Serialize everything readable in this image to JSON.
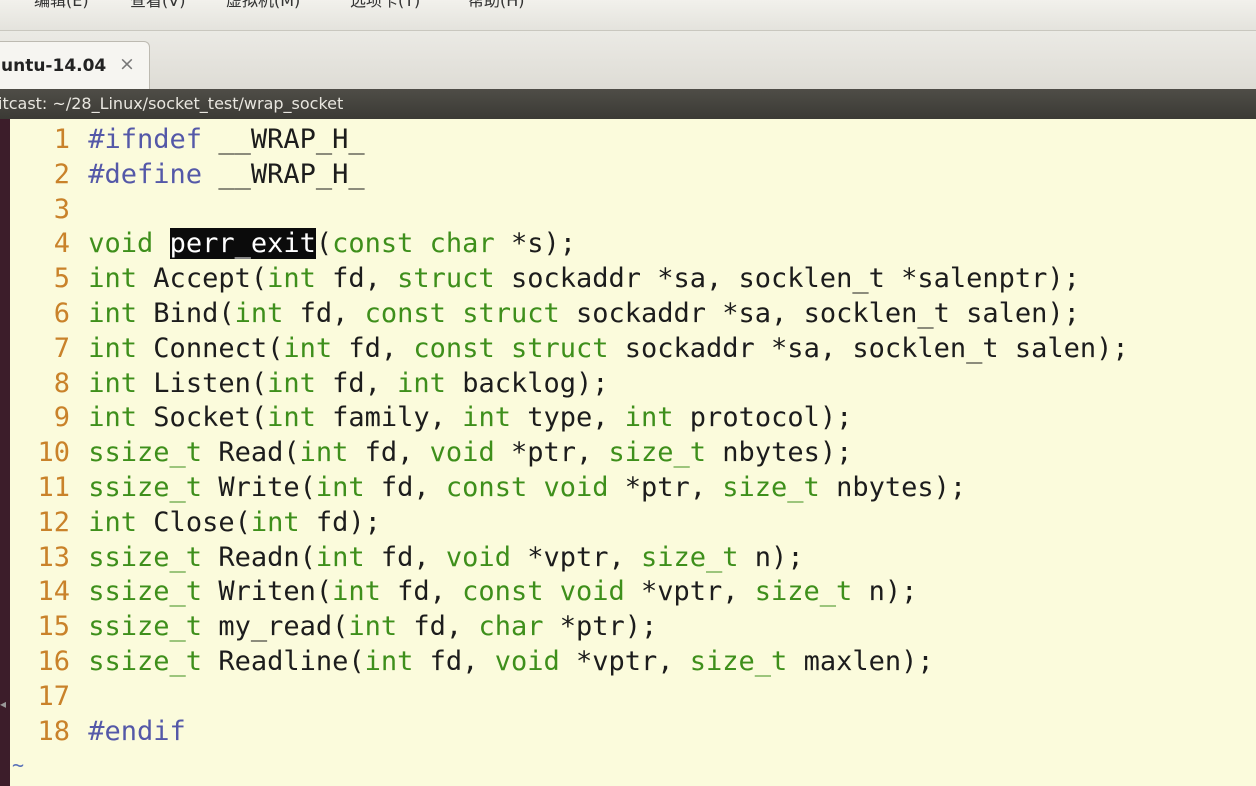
{
  "menubar": {
    "items": [
      "",
      "编辑(E)",
      "查看(V)",
      "虚拟机(M)",
      "选项卡(T)",
      "帮助(H)"
    ]
  },
  "tab": {
    "title": "untu-14.04",
    "close_glyph": "×"
  },
  "terminal": {
    "title": "itcast: ~/28_Linux/socket_test/wrap_socket"
  },
  "editor": {
    "lines": [
      {
        "n": "1",
        "segs": [
          [
            "pp",
            "#ifndef"
          ],
          [
            "t",
            " __WRAP_H_"
          ]
        ]
      },
      {
        "n": "2",
        "segs": [
          [
            "pp",
            "#define"
          ],
          [
            "t",
            " __WRAP_H_"
          ]
        ]
      },
      {
        "n": "3",
        "segs": []
      },
      {
        "n": "4",
        "segs": [
          [
            "kw",
            "void"
          ],
          [
            "t",
            " "
          ],
          [
            "hl",
            "perr_exit"
          ],
          [
            "t",
            "("
          ],
          [
            "kw",
            "const char"
          ],
          [
            "t",
            " *s);"
          ]
        ]
      },
      {
        "n": "5",
        "segs": [
          [
            "kw",
            "int"
          ],
          [
            "t",
            " Accept("
          ],
          [
            "kw",
            "int"
          ],
          [
            "t",
            " fd, "
          ],
          [
            "kw",
            "struct"
          ],
          [
            "t",
            " sockaddr *sa, socklen_t *salenptr);"
          ]
        ]
      },
      {
        "n": "6",
        "segs": [
          [
            "kw",
            "int"
          ],
          [
            "t",
            " Bind("
          ],
          [
            "kw",
            "int"
          ],
          [
            "t",
            " fd, "
          ],
          [
            "kw",
            "const struct"
          ],
          [
            "t",
            " sockaddr *sa, socklen_t salen);"
          ]
        ]
      },
      {
        "n": "7",
        "segs": [
          [
            "kw",
            "int"
          ],
          [
            "t",
            " Connect("
          ],
          [
            "kw",
            "int"
          ],
          [
            "t",
            " fd, "
          ],
          [
            "kw",
            "const struct"
          ],
          [
            "t",
            " sockaddr *sa, socklen_t salen);"
          ]
        ]
      },
      {
        "n": "8",
        "segs": [
          [
            "kw",
            "int"
          ],
          [
            "t",
            " Listen("
          ],
          [
            "kw",
            "int"
          ],
          [
            "t",
            " fd, "
          ],
          [
            "kw",
            "int"
          ],
          [
            "t",
            " backlog);"
          ]
        ]
      },
      {
        "n": "9",
        "segs": [
          [
            "kw",
            "int"
          ],
          [
            "t",
            " Socket("
          ],
          [
            "kw",
            "int"
          ],
          [
            "t",
            " family, "
          ],
          [
            "kw",
            "int"
          ],
          [
            "t",
            " type, "
          ],
          [
            "kw",
            "int"
          ],
          [
            "t",
            " protocol);"
          ]
        ]
      },
      {
        "n": "10",
        "segs": [
          [
            "kw",
            "ssize_t"
          ],
          [
            "t",
            " Read("
          ],
          [
            "kw",
            "int"
          ],
          [
            "t",
            " fd, "
          ],
          [
            "kw",
            "void"
          ],
          [
            "t",
            " *ptr, "
          ],
          [
            "kw",
            "size_t"
          ],
          [
            "t",
            " nbytes);"
          ]
        ]
      },
      {
        "n": "11",
        "segs": [
          [
            "kw",
            "ssize_t"
          ],
          [
            "t",
            " Write("
          ],
          [
            "kw",
            "int"
          ],
          [
            "t",
            " fd, "
          ],
          [
            "kw",
            "const void"
          ],
          [
            "t",
            " *ptr, "
          ],
          [
            "kw",
            "size_t"
          ],
          [
            "t",
            " nbytes);"
          ]
        ]
      },
      {
        "n": "12",
        "segs": [
          [
            "kw",
            "int"
          ],
          [
            "t",
            " Close("
          ],
          [
            "kw",
            "int"
          ],
          [
            "t",
            " fd);"
          ]
        ]
      },
      {
        "n": "13",
        "segs": [
          [
            "kw",
            "ssize_t"
          ],
          [
            "t",
            " Readn("
          ],
          [
            "kw",
            "int"
          ],
          [
            "t",
            " fd, "
          ],
          [
            "kw",
            "void"
          ],
          [
            "t",
            " *vptr, "
          ],
          [
            "kw",
            "size_t"
          ],
          [
            "t",
            " n);"
          ]
        ]
      },
      {
        "n": "14",
        "segs": [
          [
            "kw",
            "ssize_t"
          ],
          [
            "t",
            " Writen("
          ],
          [
            "kw",
            "int"
          ],
          [
            "t",
            " fd, "
          ],
          [
            "kw",
            "const void"
          ],
          [
            "t",
            " *vptr, "
          ],
          [
            "kw",
            "size_t"
          ],
          [
            "t",
            " n);"
          ]
        ]
      },
      {
        "n": "15",
        "segs": [
          [
            "kw",
            "ssize_t"
          ],
          [
            "t",
            " my_read("
          ],
          [
            "kw",
            "int"
          ],
          [
            "t",
            " fd, "
          ],
          [
            "kw",
            "char"
          ],
          [
            "t",
            " *ptr);"
          ]
        ]
      },
      {
        "n": "16",
        "segs": [
          [
            "kw",
            "ssize_t"
          ],
          [
            "t",
            " Readline("
          ],
          [
            "kw",
            "int"
          ],
          [
            "t",
            " fd, "
          ],
          [
            "kw",
            "void"
          ],
          [
            "t",
            " *vptr, "
          ],
          [
            "kw",
            "size_t"
          ],
          [
            "t",
            " maxlen);"
          ]
        ]
      },
      {
        "n": "17",
        "segs": []
      },
      {
        "n": "18",
        "segs": [
          [
            "pp",
            "#endif"
          ]
        ]
      }
    ],
    "tilde": "~"
  },
  "colors": {
    "keyword": "#3e8f1b",
    "preprocessor": "#5458a8",
    "line_number": "#c9822a",
    "background": "#fbfbdc",
    "highlight_bg": "#0b0b0b"
  }
}
